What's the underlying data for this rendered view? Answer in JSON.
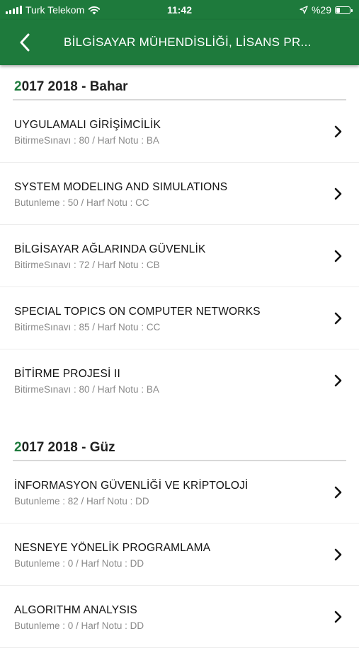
{
  "status_bar": {
    "carrier": "Turk Telekom",
    "time": "11:42",
    "battery_percent_label": "%29",
    "battery_level": 0.29,
    "icons": [
      "signal-bars-icon",
      "wifi-icon",
      "location-arrow-icon",
      "battery-icon"
    ]
  },
  "navbar": {
    "title": "BİLGİSAYAR MÜHENDİSLİĞİ, LİSANS PR...",
    "back_icon": "chevron-left-icon"
  },
  "colors": {
    "brand_green": "#1e7a3c",
    "detail_gray": "#8a8a8a"
  },
  "sections": [
    {
      "title_first": "2",
      "title_rest": "017 2018 - Bahar",
      "courses": [
        {
          "name": "UYGULAMALI GİRİŞİMCİLİK",
          "detail": "BitirmeSınavı : 80 / Harf Notu : BA"
        },
        {
          "name": "SYSTEM MODELING AND SIMULATIONS",
          "detail": "Butunleme : 50 / Harf Notu : CC"
        },
        {
          "name": "BİLGİSAYAR AĞLARINDA GÜVENLİK",
          "detail": "BitirmeSınavı : 72 / Harf Notu : CB"
        },
        {
          "name": "SPECIAL TOPICS ON COMPUTER NETWORKS",
          "detail": "BitirmeSınavı : 85 / Harf Notu : CC"
        },
        {
          "name": "BİTİRME PROJESİ II",
          "detail": "BitirmeSınavı : 80 / Harf Notu : BA"
        }
      ]
    },
    {
      "title_first": "2",
      "title_rest": "017 2018 - Güz",
      "courses": [
        {
          "name": "İNFORMASYON GÜVENLİĞİ VE KRİPTOLOJİ",
          "detail": "Butunleme : 82 / Harf Notu : DD"
        },
        {
          "name": "NESNEYE YÖNELİK PROGRAMLAMA",
          "detail": "Butunleme : 0 / Harf Notu : DD"
        },
        {
          "name": "ALGORITHM ANALYSIS",
          "detail": "Butunleme : 0 / Harf Notu : DD"
        }
      ]
    }
  ]
}
